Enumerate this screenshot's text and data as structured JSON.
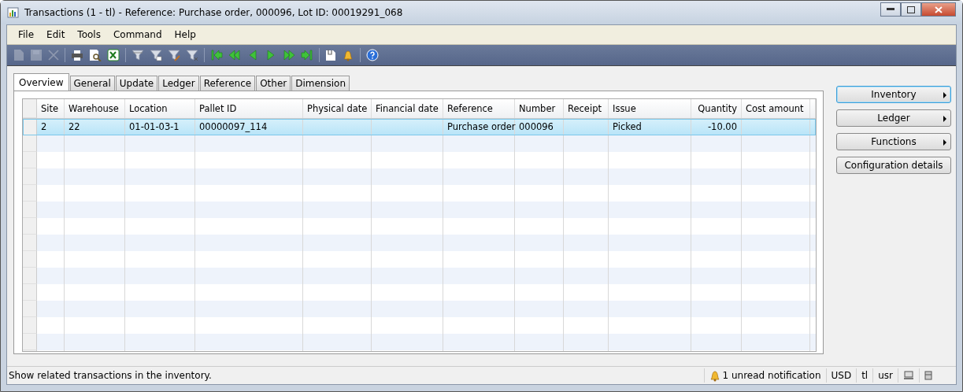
{
  "window": {
    "title": "Transactions (1 - tl) - Reference: Purchase order, 000096, Lot ID: 00019291_068"
  },
  "menu": [
    "File",
    "Edit",
    "Tools",
    "Command",
    "Help"
  ],
  "toolbar": [
    {
      "kind": "new",
      "disabled": true
    },
    {
      "kind": "save",
      "disabled": true
    },
    {
      "kind": "delete",
      "disabled": true
    },
    {
      "kind": "separator"
    },
    {
      "kind": "print",
      "disabled": false
    },
    {
      "kind": "preview",
      "disabled": false
    },
    {
      "kind": "excel",
      "disabled": false
    },
    {
      "kind": "separator"
    },
    {
      "kind": "filter-selection",
      "disabled": false
    },
    {
      "kind": "filter-grid",
      "disabled": false
    },
    {
      "kind": "filter-advanced",
      "disabled": false
    },
    {
      "kind": "filter-remove",
      "disabled": false
    },
    {
      "kind": "separator"
    },
    {
      "kind": "first",
      "disabled": false
    },
    {
      "kind": "prev-page",
      "disabled": false
    },
    {
      "kind": "prev",
      "disabled": false
    },
    {
      "kind": "next",
      "disabled": false
    },
    {
      "kind": "next-page",
      "disabled": false
    },
    {
      "kind": "last",
      "disabled": false
    },
    {
      "kind": "separator"
    },
    {
      "kind": "attach",
      "disabled": false
    },
    {
      "kind": "alert",
      "disabled": false
    },
    {
      "kind": "separator"
    },
    {
      "kind": "help",
      "disabled": false
    }
  ],
  "tabs": [
    {
      "label": "Overview",
      "selected": true
    },
    {
      "label": "General",
      "selected": false
    },
    {
      "label": "Update",
      "selected": false
    },
    {
      "label": "Ledger",
      "selected": false
    },
    {
      "label": "Reference",
      "selected": false
    },
    {
      "label": "Other",
      "selected": false
    },
    {
      "label": "Dimension",
      "selected": false
    }
  ],
  "table": {
    "columns": [
      "Site",
      "Warehouse",
      "Location",
      "Pallet ID",
      "Physical date",
      "Financial date",
      "Reference",
      "Number",
      "Receipt",
      "Issue",
      "Quantity",
      "Cost amount"
    ],
    "rows": [
      {
        "selected": true,
        "cells": [
          "2",
          "22",
          "01-01-03-1",
          "00000097_114",
          "",
          "",
          "Purchase order",
          "000096",
          "",
          "Picked",
          "-10.00",
          ""
        ]
      }
    ]
  },
  "side_buttons": [
    {
      "label": "Inventory",
      "kind": "menu",
      "focused": true
    },
    {
      "label": "Ledger",
      "kind": "menu",
      "focused": false
    },
    {
      "label": "Functions",
      "kind": "menu",
      "focused": false
    },
    {
      "label": "Configuration details",
      "kind": "plain",
      "focused": false
    }
  ],
  "status_bar": {
    "message": "Show related transactions in the inventory.",
    "notification": "1 unread notification",
    "currency": "USD",
    "company": "tl",
    "user": "usr"
  }
}
